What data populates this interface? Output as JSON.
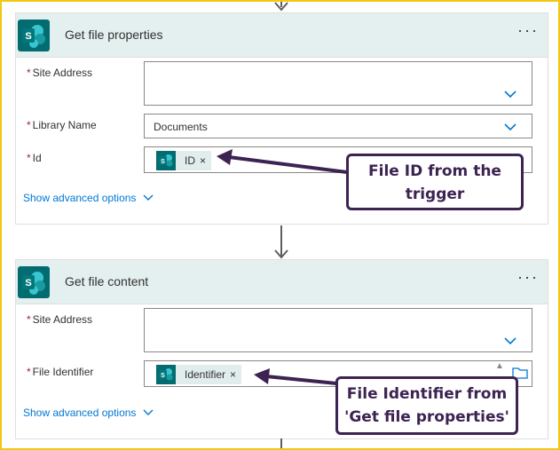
{
  "colors": {
    "brand": "#036c70",
    "header_bg": "#e3f0ef",
    "link": "#0078d4",
    "required": "#a4262c",
    "callout": "#3c2352",
    "frame": "#f2c811"
  },
  "card1": {
    "title": "Get file properties",
    "more_icon": "more-icon",
    "fields": {
      "site_address": {
        "label": "Site Address",
        "required_mark": "*",
        "value": ""
      },
      "library_name": {
        "label": "Library Name",
        "required_mark": "*",
        "value": "Documents"
      },
      "id": {
        "label": "Id",
        "required_mark": "*",
        "token": "ID",
        "token_remove": "×"
      }
    },
    "advanced_link": "Show advanced options"
  },
  "card2": {
    "title": "Get file content",
    "more_icon": "more-icon",
    "fields": {
      "site_address": {
        "label": "Site Address",
        "required_mark": "*",
        "value": ""
      },
      "file_identifier": {
        "label": "File Identifier",
        "required_mark": "*",
        "token": "Identifier",
        "token_remove": "×"
      }
    },
    "advanced_link": "Show advanced options"
  },
  "callouts": {
    "first": {
      "line1": "File ID from the",
      "line2": "trigger"
    },
    "second": {
      "line1": "File Identifier from",
      "line2": "'Get file properties'"
    }
  }
}
